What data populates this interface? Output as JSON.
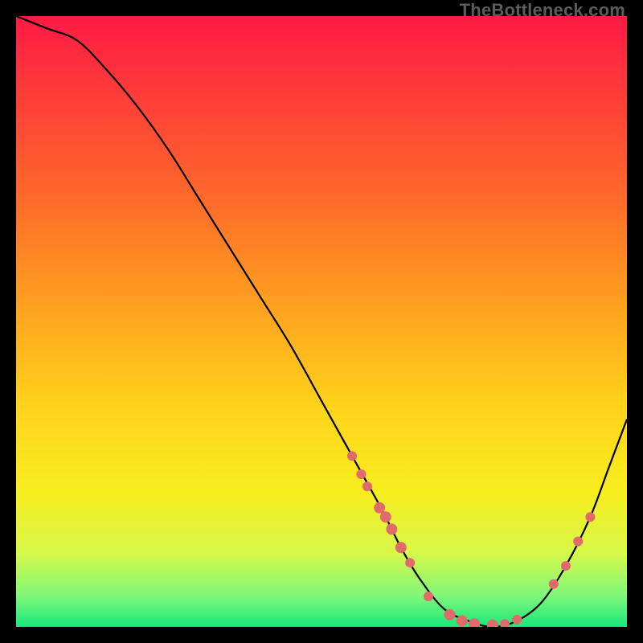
{
  "watermark": "TheBottleneck.com",
  "chart_data": {
    "type": "line",
    "title": "",
    "xlabel": "",
    "ylabel": "",
    "xlim": [
      0,
      100
    ],
    "ylim": [
      0,
      100
    ],
    "grid": false,
    "legend": false,
    "series": [
      {
        "name": "bottleneck-curve",
        "x": [
          0,
          5,
          10,
          15,
          20,
          25,
          30,
          35,
          40,
          45,
          50,
          55,
          60,
          63,
          66,
          70,
          74,
          78,
          82,
          86,
          90,
          94,
          97,
          100
        ],
        "y": [
          100,
          98,
          96,
          91,
          85,
          78,
          70,
          62,
          54,
          46,
          37,
          28,
          19,
          13,
          8,
          3,
          1,
          0,
          1,
          4,
          10,
          18,
          26,
          34
        ]
      }
    ],
    "scatter_points": {
      "name": "highlighted-points",
      "color": "#e26a6a",
      "points": [
        {
          "x": 55,
          "y": 28,
          "r": 6
        },
        {
          "x": 56.5,
          "y": 25,
          "r": 6
        },
        {
          "x": 57.5,
          "y": 23,
          "r": 6
        },
        {
          "x": 59.5,
          "y": 19.5,
          "r": 7
        },
        {
          "x": 60.5,
          "y": 18,
          "r": 7
        },
        {
          "x": 61.5,
          "y": 16,
          "r": 7
        },
        {
          "x": 63,
          "y": 13,
          "r": 7
        },
        {
          "x": 64.5,
          "y": 10.5,
          "r": 6
        },
        {
          "x": 67.5,
          "y": 5,
          "r": 6
        },
        {
          "x": 71,
          "y": 2,
          "r": 7
        },
        {
          "x": 73,
          "y": 1,
          "r": 7
        },
        {
          "x": 75,
          "y": 0.5,
          "r": 7
        },
        {
          "x": 78,
          "y": 0.3,
          "r": 7
        },
        {
          "x": 80,
          "y": 0.5,
          "r": 6
        },
        {
          "x": 82,
          "y": 1.2,
          "r": 6
        },
        {
          "x": 88,
          "y": 7,
          "r": 6
        },
        {
          "x": 90,
          "y": 10,
          "r": 6
        },
        {
          "x": 92,
          "y": 14,
          "r": 6
        },
        {
          "x": 94,
          "y": 18,
          "r": 6
        }
      ]
    },
    "gradient_stops": [
      {
        "offset": 0.0,
        "color": "#ff1a44"
      },
      {
        "offset": 0.12,
        "color": "#ff3a3a"
      },
      {
        "offset": 0.3,
        "color": "#ff6a2a"
      },
      {
        "offset": 0.48,
        "color": "#ffa31f"
      },
      {
        "offset": 0.64,
        "color": "#ffd31a"
      },
      {
        "offset": 0.78,
        "color": "#f7ee1e"
      },
      {
        "offset": 0.88,
        "color": "#d6f84a"
      },
      {
        "offset": 0.95,
        "color": "#7ef77a"
      },
      {
        "offset": 1.0,
        "color": "#18e87a"
      }
    ]
  }
}
